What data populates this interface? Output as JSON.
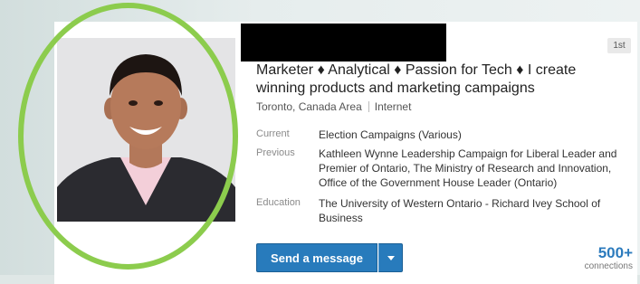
{
  "profile": {
    "degree_badge": "1st",
    "headline": "Marketer ♦ Analytical ♦ Passion for Tech ♦ I create winning products and marketing campaigns",
    "location": "Toronto, Canada Area",
    "industry": "Internet",
    "current": {
      "label": "Current",
      "value": "Election Campaigns (Various)"
    },
    "previous": {
      "label": "Previous",
      "value": "Kathleen Wynne Leadership Campaign for Liberal Leader and Premier of Ontario, The Ministry of Research and Innovation, Office of the Government House Leader (Ontario)"
    },
    "education": {
      "label": "Education",
      "value": "The University of Western Ontario - Richard Ivey School of Business"
    }
  },
  "actions": {
    "send_message_label": "Send a message",
    "dropdown_icon": "caret-down-icon"
  },
  "connections": {
    "count": "500+",
    "label": "connections"
  },
  "colors": {
    "primary_button": "#287bbc",
    "connections_link": "#2c7bbd",
    "highlight_circle": "#8ccc4d",
    "name_redaction": "#000000"
  }
}
